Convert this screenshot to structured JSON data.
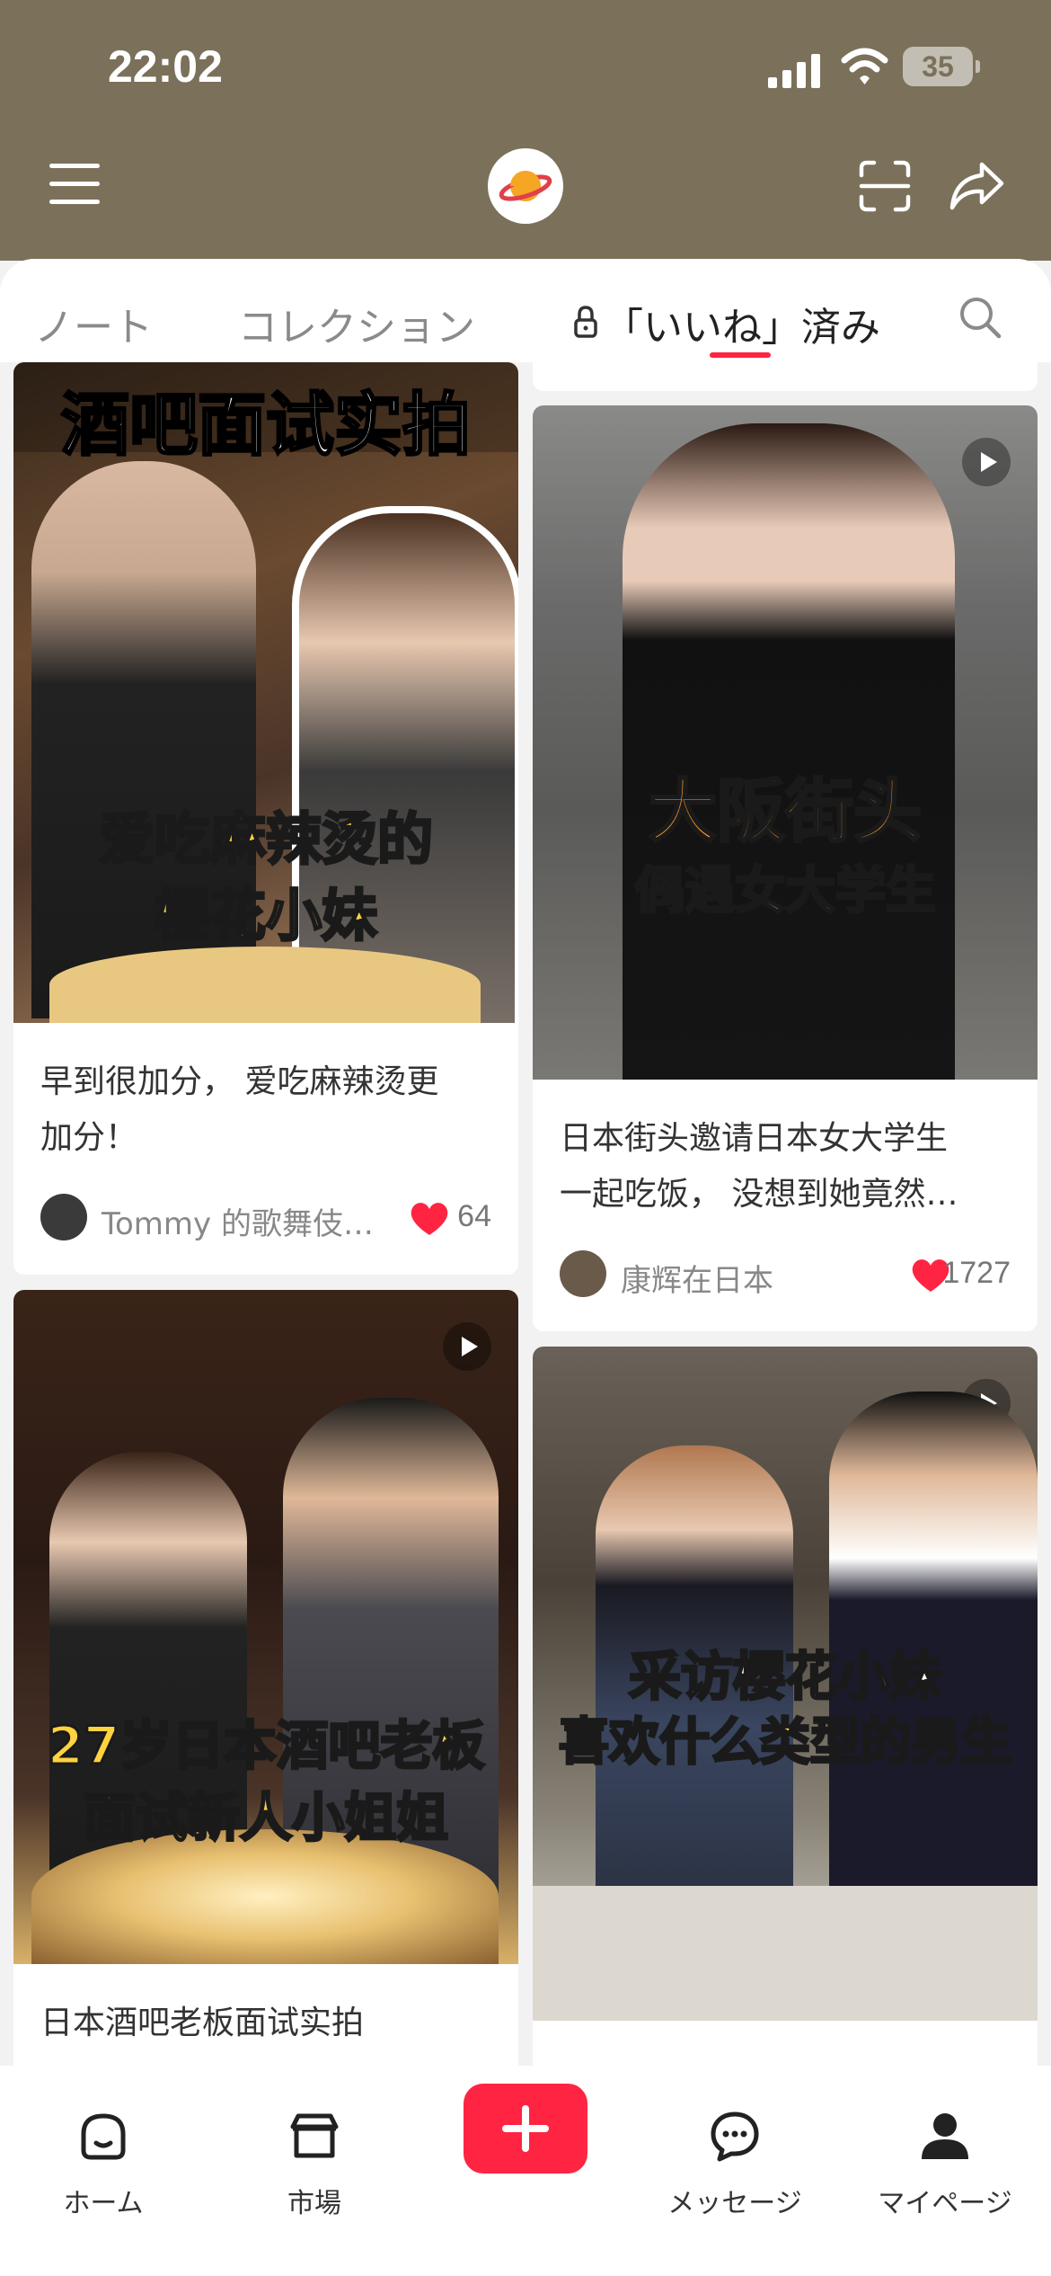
{
  "status": {
    "time": "22:02",
    "battery": "35"
  },
  "tabs": {
    "notes": "ノート",
    "collection": "コレクション",
    "liked": "「いいね」済み"
  },
  "feed": {
    "left": [
      {
        "overlay_top": "酒吧面试实拍",
        "overlay_main": "爱吃麻辣烫的",
        "overlay_sub": "樱花小妹",
        "title_line1": "早到很加分， 爱吃麻辣烫更",
        "title_line2": "加分！",
        "author": "Tommy 的歌舞伎…",
        "likes": "64"
      },
      {
        "overlay_main": "27岁日本酒吧老板",
        "overlay_sub": "面试新人小姐姐",
        "title_line1": "日本酒吧老板面试实拍"
      }
    ],
    "right": [
      {
        "overlay_main": "大阪街头",
        "overlay_sub": "偶遇女大学生",
        "title_line1": "日本街头邀请日本女大学生",
        "title_line2": "一起吃饭， 没想到她竟然…",
        "author": "康辉在日本",
        "likes": "1727"
      },
      {
        "overlay_main": "采访樱花小妹",
        "overlay_sub": "喜欢什么类型的男生"
      }
    ]
  },
  "nav": {
    "home": "ホーム",
    "market": "市場",
    "messages": "メッセージ",
    "mypage": "マイページ"
  },
  "colors": {
    "header": "#7b705a",
    "accent": "#ff2442"
  }
}
